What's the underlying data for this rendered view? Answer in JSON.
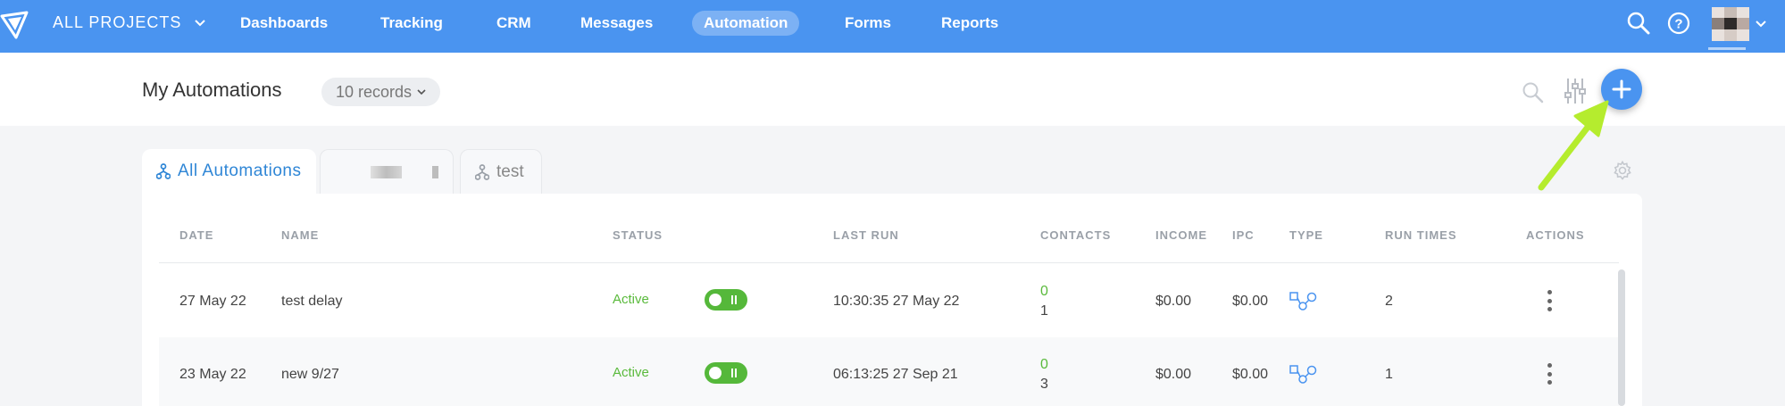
{
  "nav": {
    "projects_label": "ALL PROJECTS",
    "items": [
      {
        "label": "Dashboards"
      },
      {
        "label": "Tracking"
      },
      {
        "label": "CRM"
      },
      {
        "label": "Messages"
      },
      {
        "label": "Automation",
        "active": true
      },
      {
        "label": "Forms"
      },
      {
        "label": "Reports"
      }
    ],
    "icons": [
      "logo-icon",
      "search-icon",
      "help-icon",
      "avatar",
      "chevron-down-icon"
    ]
  },
  "header": {
    "title": "My Automations",
    "records_label": "10 records",
    "icons": [
      "search-icon",
      "filter-sliders-icon",
      "plus-icon"
    ]
  },
  "tabs": [
    {
      "label": "All Automations",
      "active": true,
      "icon": "workflow-icon"
    },
    {
      "label": "",
      "blurred": true
    },
    {
      "label": "test",
      "icon": "workflow-icon"
    }
  ],
  "table": {
    "columns": [
      "DATE",
      "NAME",
      "STATUS",
      "LAST RUN",
      "CONTACTS",
      "INCOME",
      "IPC",
      "TYPE",
      "RUN TIMES",
      "ACTIONS"
    ],
    "rows": [
      {
        "date": "27 May 22",
        "name": "test delay",
        "status": "Active",
        "toggle_on": true,
        "last_run": "10:30:35 27 May 22",
        "contacts_top": "0",
        "contacts_bottom": "1",
        "income": "$0.00",
        "ipc": "$0.00",
        "type_icon": "flow-type-icon",
        "run_times": "2"
      },
      {
        "date": "23 May 22",
        "name": "new 9/27",
        "status": "Active",
        "toggle_on": true,
        "last_run": "06:13:25 27 Sep 21",
        "contacts_top": "0",
        "contacts_bottom": "3",
        "income": "$0.00",
        "ipc": "$0.00",
        "type_icon": "flow-type-icon",
        "run_times": "1"
      }
    ]
  },
  "colors": {
    "topbar": "#4a94f0",
    "active_green": "#5aba3c",
    "tab_active_text": "#2f86d6",
    "arrow": "#b5ec2e"
  }
}
